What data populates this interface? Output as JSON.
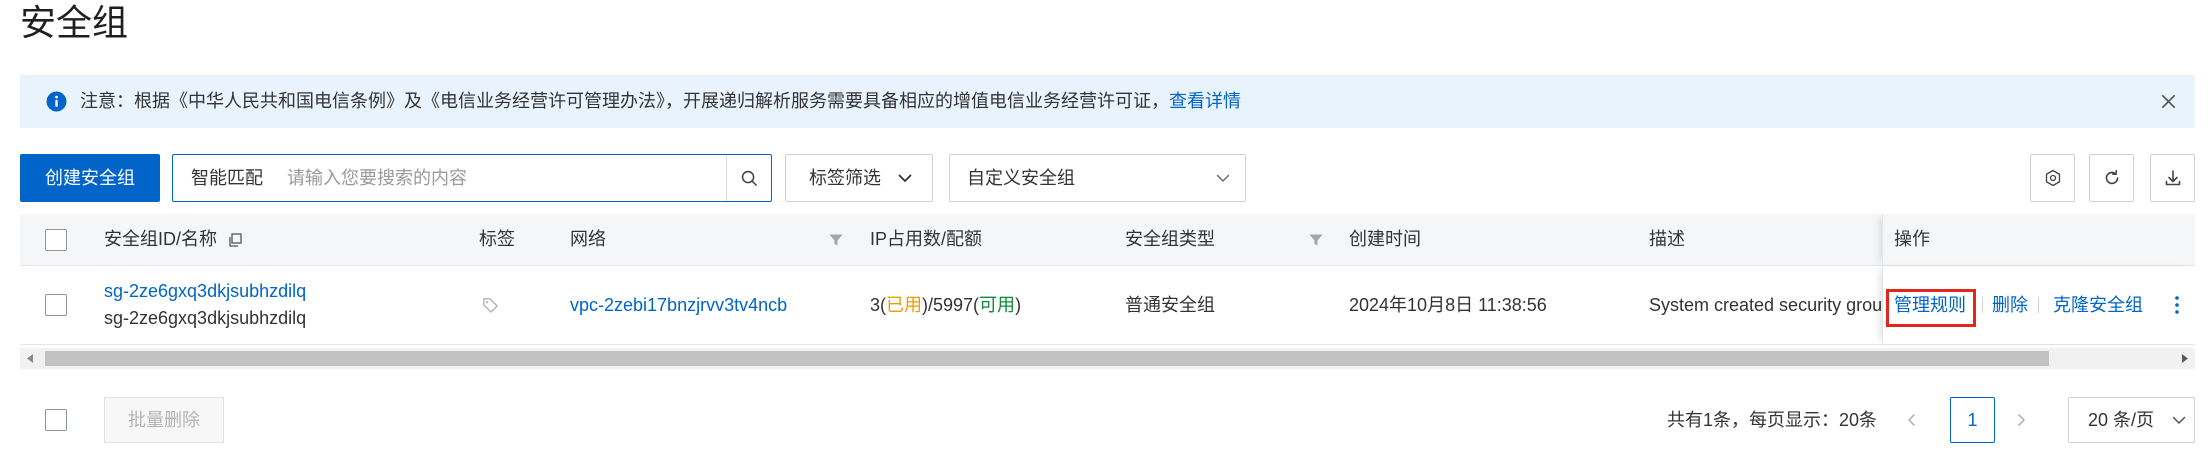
{
  "page": {
    "title": "安全组"
  },
  "notice": {
    "icon": "info-icon",
    "text": "注意：根据《中华人民共和国电信条例》及《电信业务经营许可管理办法》，开展递归解析服务需要具备相应的增值电信业务经营许可证，",
    "link": "查看详情",
    "close_icon": "close-icon"
  },
  "toolbar": {
    "create_button": "创建安全组",
    "search_mode": "智能匹配",
    "search_placeholder": "请输入您要搜索的内容",
    "search_icon": "search-icon",
    "tag_filter": "标签筛选",
    "group_filter": "自定义安全组",
    "icon_buttons": [
      "settings-icon",
      "refresh-icon",
      "download-icon"
    ]
  },
  "table": {
    "columns": {
      "id_name": "安全组ID/名称",
      "tags": "标签",
      "network": "网络",
      "ip_usage": "IP占用数/配额",
      "type": "安全组类型",
      "created_at": "创建时间",
      "description": "描述",
      "actions": "操作"
    },
    "column_icons": [
      "copy-icon",
      "filter-icon"
    ],
    "rows": [
      {
        "id": "sg-2ze6gxq3dkjsubhzdilq",
        "name": "sg-2ze6gxq3dkjsubhzdilq",
        "tag_icon": "tag-icon",
        "vpc": "vpc-2zebi17bnzjrvv3tv4ncb",
        "ip_usage": {
          "used_text": "3(",
          "used_label": "已用",
          "quota_text": ")/5997(",
          "quota_label": "可用",
          "end_text": ")"
        },
        "type": "普通安全组",
        "created_at": "2024年10月8日 11:38:56",
        "description": "System created security group",
        "actions": {
          "manage_rules": "管理规则",
          "delete": "删除",
          "clone": "克隆安全组",
          "more_icon": "more-vertical-icon"
        }
      }
    ]
  },
  "footer": {
    "batch_delete": "批量删除"
  },
  "pagination": {
    "summary": "共有1条，每页显示：20条",
    "current_page": "1",
    "page_size": "20 条/页"
  },
  "colors": {
    "primary": "#0064c8",
    "notice_bg": "#e8f3fe",
    "header_bg": "#f5f6f8",
    "used": "#f19a00",
    "available": "#12893a",
    "highlight": "#e3251e"
  }
}
